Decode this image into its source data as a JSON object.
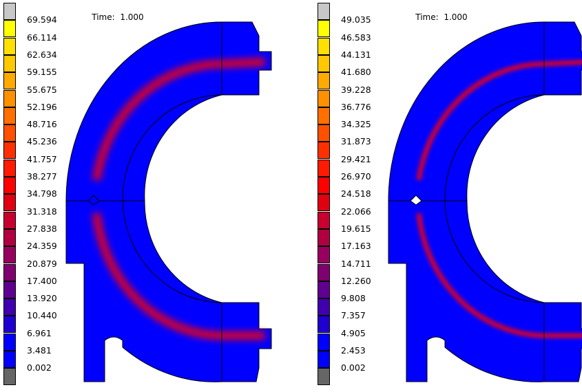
{
  "left_panel": {
    "time_label": "Time:",
    "time_value": "1.000",
    "legend_values": [
      "69.594",
      "66.114",
      "62.634",
      "59.155",
      "55.675",
      "52.196",
      "48.716",
      "45.236",
      "41.757",
      "38.277",
      "34.798",
      "31.318",
      "27.838",
      "24.359",
      "20.879",
      "17.400",
      "13.920",
      "10.440",
      "6.961",
      "3.481",
      "0.002"
    ]
  },
  "right_panel": {
    "time_label": "Time:",
    "time_value": "1.000",
    "legend_values": [
      "49.035",
      "46.583",
      "44.131",
      "41.680",
      "39.228",
      "36.776",
      "34.325",
      "31.873",
      "29.421",
      "26.970",
      "24.518",
      "22.066",
      "19.615",
      "17.163",
      "14.711",
      "12.260",
      "9.808",
      "7.357",
      "4.905",
      "2.453",
      "0.002"
    ]
  },
  "legend_colors": [
    "#c8c8c8",
    "#ffff00",
    "#ffe000",
    "#ffc800",
    "#ffaa00",
    "#ff9000",
    "#ff7000",
    "#ff5000",
    "#ff3000",
    "#ff1a00",
    "#ff0000",
    "#e00010",
    "#c80030",
    "#b00040",
    "#980060",
    "#800070",
    "#600090",
    "#4000b0",
    "#2000d0",
    "#0000ff",
    "#0000ff",
    "#666666"
  ],
  "field_colors": {
    "base": "#0000ff",
    "hot": "#ff0000"
  }
}
